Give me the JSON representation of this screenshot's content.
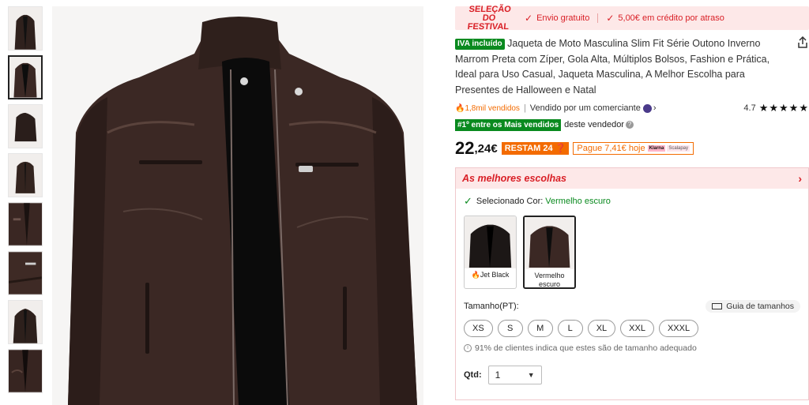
{
  "thumbnails": [
    {
      "name": "thumb-1"
    },
    {
      "name": "thumb-2",
      "active": true
    },
    {
      "name": "thumb-3"
    },
    {
      "name": "thumb-4"
    },
    {
      "name": "thumb-5"
    },
    {
      "name": "thumb-6"
    },
    {
      "name": "thumb-7"
    },
    {
      "name": "thumb-8"
    }
  ],
  "banner": {
    "logo_line1": "SELEÇÃO DO",
    "logo_line2": "FESTIVAL",
    "shipping": "Envio gratuito",
    "credit": "5,00€ em crédito por atraso"
  },
  "product": {
    "iva_badge": "IVA incluído",
    "title": "Jaqueta de Moto Masculina Slim Fit Série Outono Inverno Marrom Preta com Zíper, Gola Alta, Múltiplos Bolsos, Fashion e Prática, Ideal para Uso Casual, Jaqueta Masculina, A Melhor Escolha para Presentes de Halloween e Natal",
    "sold": "1,8mil vendidos",
    "seller": "Vendido por um comerciante",
    "rating": "4.7",
    "stars": "★★★★★",
    "best_badge": "#1º entre os Mais vendidos",
    "best_suffix": "deste vendedor"
  },
  "price": {
    "integer": "22",
    "decimal": ",24€",
    "remain": "RESTAM 24",
    "pay_today": "Pague 7,41€ hoje",
    "klarna": "Klarna",
    "pay_logo2": "Scalapay"
  },
  "best_choices": {
    "title": "As melhores escolhas",
    "selected_label": "Selecionado Cor:",
    "selected_value": "Vermelho escuro",
    "swatches": [
      {
        "label": "Jet Black",
        "hot": true
      },
      {
        "label": "Vermelho escuro",
        "active": true
      }
    ],
    "size_label": "Tamanho(PT):",
    "size_guide": "Guia de tamanhos",
    "sizes": [
      "XS",
      "S",
      "M",
      "L",
      "XL",
      "XXL",
      "XXXL"
    ],
    "fit_note": "91% de clientes indica que estes são de tamanho adequado",
    "qty_label": "Qtd:",
    "qty_value": "1"
  },
  "colors": {
    "accent_red": "#d91f26",
    "orange": "#f36b00",
    "green": "#0a8a1f",
    "jacket_brown": "#3b2824"
  }
}
